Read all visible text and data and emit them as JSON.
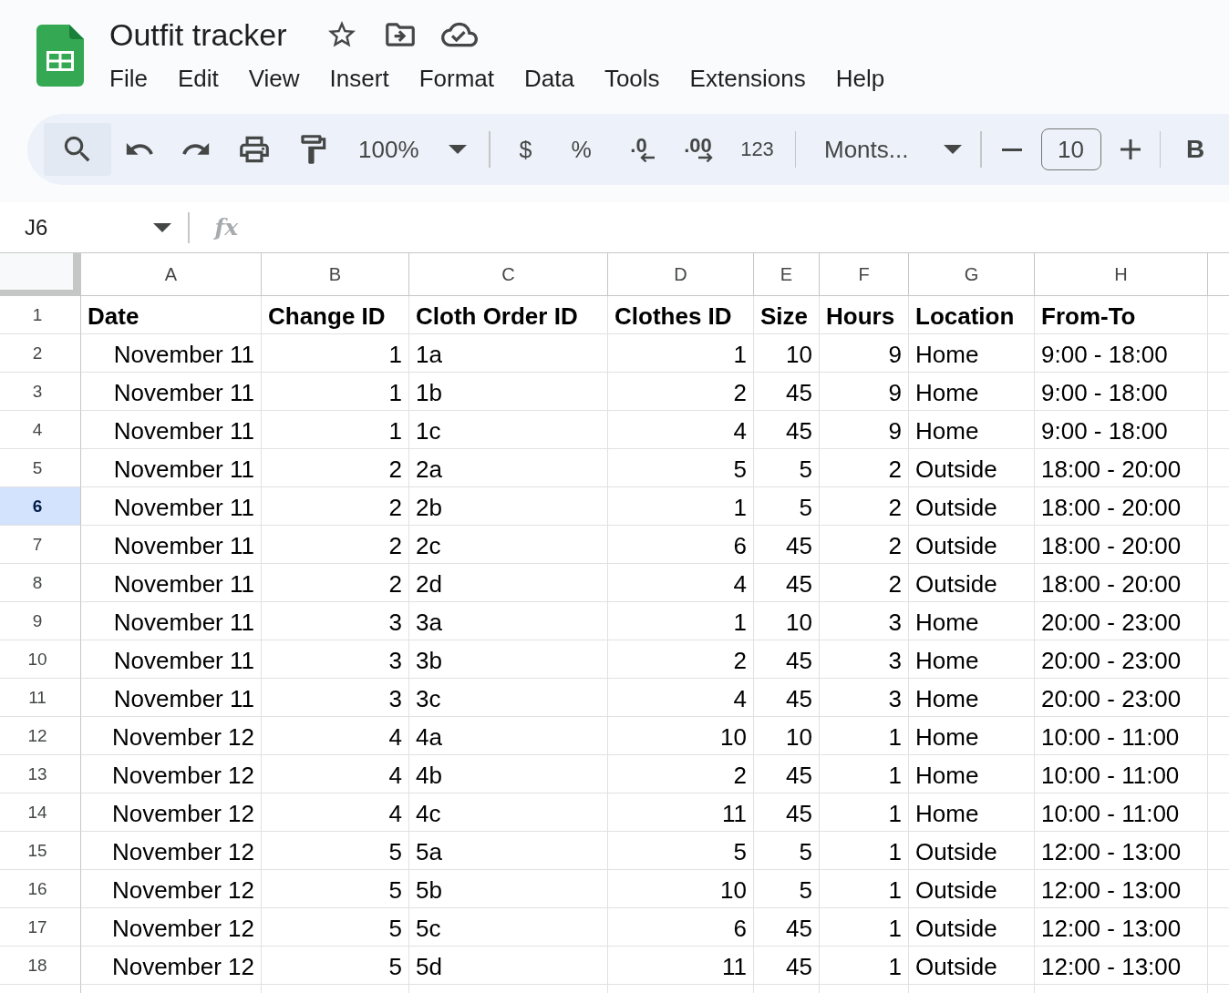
{
  "app": {
    "title": "Outfit tracker",
    "menu": [
      "File",
      "Edit",
      "View",
      "Insert",
      "Format",
      "Data",
      "Tools",
      "Extensions",
      "Help"
    ]
  },
  "toolbar": {
    "zoom": "100%",
    "currency": "$",
    "percent": "%",
    "decrease_decimal": ".0",
    "increase_decimal": ".00",
    "number_format": "123",
    "font": "Monts...",
    "font_size": "10",
    "bold": "B"
  },
  "formula_bar": {
    "name_box": "J6",
    "formula_label": "fx"
  },
  "table": {
    "columns": [
      {
        "letter": "A",
        "kind": "date"
      },
      {
        "letter": "B",
        "kind": "number"
      },
      {
        "letter": "C",
        "kind": "text"
      },
      {
        "letter": "D",
        "kind": "number"
      },
      {
        "letter": "E",
        "kind": "number"
      },
      {
        "letter": "F",
        "kind": "number"
      },
      {
        "letter": "G",
        "kind": "text"
      },
      {
        "letter": "H",
        "kind": "text"
      }
    ],
    "rows": [
      {
        "number": "1",
        "kind": "header",
        "selected": false,
        "cells": [
          "Date",
          "Change ID",
          "Cloth Order ID",
          "Clothes ID",
          "Size",
          "Hours",
          "Location",
          "From-To"
        ]
      },
      {
        "number": "2",
        "kind": "data",
        "selected": false,
        "cells": [
          "November 11",
          "1",
          "1a",
          "1",
          "10",
          "9",
          "Home",
          "9:00 - 18:00"
        ]
      },
      {
        "number": "3",
        "kind": "data",
        "selected": false,
        "cells": [
          "November 11",
          "1",
          "1b",
          "2",
          "45",
          "9",
          "Home",
          "9:00 - 18:00"
        ]
      },
      {
        "number": "4",
        "kind": "data",
        "selected": false,
        "cells": [
          "November 11",
          "1",
          "1c",
          "4",
          "45",
          "9",
          "Home",
          "9:00 - 18:00"
        ]
      },
      {
        "number": "5",
        "kind": "data",
        "selected": false,
        "cells": [
          "November 11",
          "2",
          "2a",
          "5",
          "5",
          "2",
          "Outside",
          "18:00 - 20:00"
        ]
      },
      {
        "number": "6",
        "kind": "data",
        "selected": true,
        "cells": [
          "November 11",
          "2",
          "2b",
          "1",
          "5",
          "2",
          "Outside",
          "18:00 - 20:00"
        ]
      },
      {
        "number": "7",
        "kind": "data",
        "selected": false,
        "cells": [
          "November 11",
          "2",
          "2c",
          "6",
          "45",
          "2",
          "Outside",
          "18:00 - 20:00"
        ]
      },
      {
        "number": "8",
        "kind": "data",
        "selected": false,
        "cells": [
          "November 11",
          "2",
          "2d",
          "4",
          "45",
          "2",
          "Outside",
          "18:00 - 20:00"
        ]
      },
      {
        "number": "9",
        "kind": "data",
        "selected": false,
        "cells": [
          "November 11",
          "3",
          "3a",
          "1",
          "10",
          "3",
          "Home",
          "20:00 - 23:00"
        ]
      },
      {
        "number": "10",
        "kind": "data",
        "selected": false,
        "cells": [
          "November 11",
          "3",
          "3b",
          "2",
          "45",
          "3",
          "Home",
          "20:00 - 23:00"
        ]
      },
      {
        "number": "11",
        "kind": "data",
        "selected": false,
        "cells": [
          "November 11",
          "3",
          "3c",
          "4",
          "45",
          "3",
          "Home",
          "20:00 - 23:00"
        ]
      },
      {
        "number": "12",
        "kind": "data",
        "selected": false,
        "cells": [
          "November 12",
          "4",
          "4a",
          "10",
          "10",
          "1",
          "Home",
          "10:00 - 11:00"
        ]
      },
      {
        "number": "13",
        "kind": "data",
        "selected": false,
        "cells": [
          "November 12",
          "4",
          "4b",
          "2",
          "45",
          "1",
          "Home",
          "10:00 - 11:00"
        ]
      },
      {
        "number": "14",
        "kind": "data",
        "selected": false,
        "cells": [
          "November 12",
          "4",
          "4c",
          "11",
          "45",
          "1",
          "Home",
          "10:00 - 11:00"
        ]
      },
      {
        "number": "15",
        "kind": "data",
        "selected": false,
        "cells": [
          "November 12",
          "5",
          "5a",
          "5",
          "5",
          "1",
          "Outside",
          "12:00 - 13:00"
        ]
      },
      {
        "number": "16",
        "kind": "data",
        "selected": false,
        "cells": [
          "November 12",
          "5",
          "5b",
          "10",
          "5",
          "1",
          "Outside",
          "12:00 - 13:00"
        ]
      },
      {
        "number": "17",
        "kind": "data",
        "selected": false,
        "cells": [
          "November 12",
          "5",
          "5c",
          "6",
          "45",
          "1",
          "Outside",
          "12:00 - 13:00"
        ]
      },
      {
        "number": "18",
        "kind": "data",
        "selected": false,
        "cells": [
          "November 12",
          "5",
          "5d",
          "11",
          "45",
          "1",
          "Outside",
          "12:00 - 13:00"
        ]
      }
    ]
  }
}
